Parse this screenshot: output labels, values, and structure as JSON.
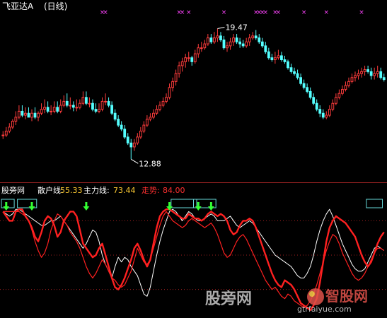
{
  "colors": {
    "background": "#000000",
    "up_candle": "#ff3c3c",
    "down_candle": "#54ffff",
    "marker": "#ff44ff",
    "main_force": "#ff2020",
    "retail": "#ffffff",
    "trend": "#ff2020",
    "signal": "#33ff33",
    "box": "#66d8d8",
    "volume": "#c84bd8",
    "divider": "#9b2222",
    "title_text": "#ffffff",
    "value_text": "#ffcc33",
    "trend_value_text": "#ff3030",
    "watermark": "#c8c8c8",
    "ref_line": "#a01f1f"
  },
  "main_panel": {
    "title": "飞亚达A",
    "period": "(日线)",
    "high_label": "19.47",
    "low_label": "12.88",
    "grid_levels": [
      "",
      "",
      ""
    ]
  },
  "indicator_panel": {
    "name": "股旁网",
    "retail_label": "散户线:",
    "retail_value": "55.33",
    "main_label": "主力线:",
    "main_value": "73.44",
    "trend_label": "走势:",
    "trend_value": "84.00"
  },
  "watermark": {
    "left_text": "股旁网",
    "right_text": "智股网",
    "url_text": "gtrfaiyue.com"
  },
  "chart_data": [
    {
      "type": "candlestick",
      "title": "飞亚达A",
      "period": "(日线)",
      "ylim": [
        12.0,
        20.2
      ],
      "annotations": [
        {
          "text": "19.47",
          "x": 67,
          "y": 19.47
        },
        {
          "text": "12.88",
          "x": 40,
          "y": 12.88
        }
      ],
      "marker_x": [
        31,
        32,
        55,
        56,
        58,
        69,
        79,
        80,
        81,
        82,
        85,
        86,
        94,
        101,
        112
      ],
      "x": [
        0,
        1,
        2,
        3,
        4,
        5,
        6,
        7,
        8,
        9,
        10,
        11,
        12,
        13,
        14,
        15,
        16,
        17,
        18,
        19,
        20,
        21,
        22,
        23,
        24,
        25,
        26,
        27,
        28,
        29,
        30,
        31,
        32,
        33,
        34,
        35,
        36,
        37,
        38,
        39,
        40,
        41,
        42,
        43,
        44,
        45,
        46,
        47,
        48,
        49,
        50,
        51,
        52,
        53,
        54,
        55,
        56,
        57,
        58,
        59,
        60,
        61,
        62,
        63,
        64,
        65,
        66,
        67,
        68,
        69,
        70,
        71,
        72,
        73,
        74,
        75,
        76,
        77,
        78,
        79,
        80,
        81,
        82,
        83,
        84,
        85,
        86,
        87,
        88,
        89,
        90,
        91,
        92,
        93,
        94,
        95,
        96,
        97,
        98,
        99,
        100,
        101,
        102,
        103,
        104,
        105,
        106,
        107,
        108,
        109,
        110,
        111,
        112,
        113,
        114,
        115,
        116,
        117,
        118,
        119
      ],
      "open": [
        14.1,
        14.1,
        14.3,
        14.5,
        14.8,
        15.0,
        15.3,
        15.1,
        15.2,
        15.0,
        15.2,
        15.0,
        15.2,
        15.4,
        15.5,
        15.3,
        15.3,
        15.5,
        15.3,
        15.6,
        15.8,
        15.6,
        15.6,
        15.5,
        15.5,
        15.7,
        16.0,
        15.7,
        15.7,
        15.4,
        15.3,
        15.4,
        15.8,
        15.8,
        15.6,
        15.2,
        14.9,
        14.6,
        14.4,
        14.0,
        13.7,
        13.5,
        13.7,
        14.0,
        14.3,
        14.6,
        14.9,
        15.0,
        15.2,
        15.4,
        15.6,
        15.8,
        16.0,
        16.5,
        16.8,
        17.2,
        17.6,
        17.8,
        18.0,
        18.0,
        17.8,
        18.2,
        18.5,
        18.5,
        18.7,
        19.0,
        18.8,
        19.0,
        19.1,
        18.9,
        18.5,
        18.6,
        18.8,
        19.0,
        18.8,
        18.7,
        18.6,
        18.8,
        19.0,
        19.1,
        19.0,
        18.8,
        18.6,
        18.3,
        18.0,
        17.9,
        18.0,
        18.1,
        17.9,
        17.8,
        17.5,
        17.3,
        17.2,
        17.0,
        16.7,
        16.5,
        16.3,
        16.0,
        15.7,
        15.4,
        15.2,
        15.0,
        15.1,
        15.4,
        15.7,
        16.0,
        16.2,
        16.4,
        16.6,
        16.8,
        17.0,
        17.1,
        17.2,
        17.3,
        17.4,
        17.3,
        17.1,
        17.2,
        17.3,
        17.0
      ],
      "high": [
        14.3,
        14.5,
        14.7,
        14.9,
        15.3,
        15.6,
        15.6,
        15.5,
        15.5,
        15.4,
        15.5,
        15.3,
        15.7,
        15.9,
        15.8,
        15.6,
        15.8,
        15.8,
        15.9,
        16.1,
        16.2,
        16.0,
        15.8,
        15.9,
        15.9,
        16.3,
        16.3,
        16.0,
        15.9,
        15.7,
        15.7,
        16.0,
        16.2,
        16.0,
        15.8,
        15.4,
        15.1,
        14.8,
        14.6,
        14.2,
        13.9,
        13.9,
        14.2,
        14.5,
        14.8,
        15.1,
        15.2,
        15.4,
        15.6,
        15.8,
        16.0,
        16.2,
        16.7,
        17.0,
        17.4,
        17.8,
        18.0,
        18.2,
        18.3,
        18.1,
        18.4,
        18.7,
        18.8,
        18.9,
        19.2,
        19.2,
        19.3,
        19.47,
        19.3,
        19.1,
        18.8,
        19.0,
        19.2,
        19.2,
        19.0,
        18.9,
        19.0,
        19.2,
        19.3,
        19.4,
        19.2,
        19.0,
        18.8,
        18.5,
        18.2,
        18.3,
        18.4,
        18.3,
        18.1,
        17.9,
        17.7,
        17.5,
        17.4,
        17.2,
        16.9,
        16.7,
        16.5,
        16.2,
        15.9,
        15.6,
        15.4,
        15.3,
        15.6,
        15.9,
        16.2,
        16.4,
        16.6,
        16.8,
        17.0,
        17.2,
        17.3,
        17.4,
        17.5,
        17.6,
        17.6,
        17.5,
        17.5,
        17.6,
        17.5,
        17.2
      ],
      "low": [
        13.9,
        14.0,
        14.2,
        14.4,
        14.6,
        14.9,
        15.0,
        14.9,
        15.0,
        14.8,
        14.9,
        14.8,
        15.1,
        15.2,
        15.2,
        15.1,
        15.2,
        15.2,
        15.2,
        15.5,
        15.5,
        15.4,
        15.3,
        15.3,
        15.4,
        15.6,
        15.6,
        15.5,
        15.3,
        15.2,
        15.2,
        15.3,
        15.6,
        15.5,
        15.1,
        14.8,
        14.5,
        14.3,
        13.9,
        13.6,
        12.88,
        13.3,
        13.6,
        13.9,
        14.2,
        14.5,
        14.8,
        14.9,
        15.1,
        15.3,
        15.5,
        15.7,
        15.9,
        16.3,
        16.6,
        17.0,
        17.3,
        17.5,
        17.8,
        17.6,
        17.7,
        18.0,
        18.3,
        18.4,
        18.6,
        18.7,
        18.7,
        18.8,
        18.8,
        18.4,
        18.3,
        18.4,
        18.6,
        18.7,
        18.5,
        18.5,
        18.5,
        18.6,
        18.9,
        18.9,
        18.7,
        18.5,
        18.2,
        17.9,
        17.8,
        17.7,
        17.9,
        17.8,
        17.7,
        17.4,
        17.2,
        17.1,
        16.9,
        16.6,
        16.4,
        16.2,
        15.9,
        15.6,
        15.3,
        15.0,
        14.9,
        14.9,
        15.0,
        15.3,
        15.6,
        15.9,
        16.1,
        16.3,
        16.5,
        16.7,
        16.8,
        16.9,
        17.0,
        17.1,
        17.2,
        16.9,
        16.9,
        17.0,
        16.9,
        16.8
      ],
      "close": [
        14.1,
        14.3,
        14.5,
        14.8,
        15.0,
        15.3,
        15.1,
        15.2,
        15.0,
        15.2,
        15.0,
        15.2,
        15.4,
        15.5,
        15.3,
        15.3,
        15.5,
        15.3,
        15.6,
        15.8,
        15.6,
        15.6,
        15.5,
        15.5,
        15.7,
        16.0,
        15.7,
        15.7,
        15.4,
        15.3,
        15.4,
        15.8,
        15.8,
        15.6,
        15.2,
        14.9,
        14.6,
        14.4,
        14.0,
        13.7,
        13.5,
        13.7,
        14.0,
        14.3,
        14.6,
        14.9,
        15.0,
        15.2,
        15.4,
        15.6,
        15.8,
        16.0,
        16.5,
        16.8,
        17.2,
        17.6,
        17.8,
        18.0,
        18.0,
        17.8,
        18.2,
        18.5,
        18.5,
        18.7,
        19.0,
        18.8,
        19.0,
        19.1,
        18.9,
        18.5,
        18.6,
        18.8,
        19.0,
        18.8,
        18.7,
        18.6,
        18.8,
        19.0,
        19.1,
        19.0,
        18.8,
        18.6,
        18.3,
        18.0,
        17.9,
        18.0,
        18.1,
        17.9,
        17.8,
        17.5,
        17.3,
        17.2,
        17.0,
        16.7,
        16.5,
        16.3,
        16.0,
        15.7,
        15.4,
        15.2,
        15.0,
        15.1,
        15.4,
        15.7,
        16.0,
        16.2,
        16.4,
        16.6,
        16.8,
        17.0,
        17.1,
        17.2,
        17.3,
        17.4,
        17.3,
        17.1,
        17.2,
        17.3,
        17.0,
        16.9
      ]
    },
    {
      "type": "line",
      "title": "股旁网",
      "ylim": [
        0,
        100
      ],
      "x": [
        0,
        1,
        2,
        3,
        4,
        5,
        6,
        7,
        8,
        9,
        10,
        11,
        12,
        13,
        14,
        15,
        16,
        17,
        18,
        19,
        20,
        21,
        22,
        23,
        24,
        25,
        26,
        27,
        28,
        29,
        30,
        31,
        32,
        33,
        34,
        35,
        36,
        37,
        38,
        39,
        40,
        41,
        42,
        43,
        44,
        45,
        46,
        47,
        48,
        49,
        50,
        51,
        52,
        53,
        54,
        55,
        56,
        57,
        58,
        59,
        60,
        61,
        62,
        63,
        64,
        65,
        66,
        67,
        68,
        69,
        70,
        71,
        72,
        73,
        74,
        75,
        76,
        77,
        78,
        79,
        80,
        81,
        82,
        83,
        84,
        85,
        86,
        87,
        88,
        89,
        90,
        91,
        92,
        93,
        94,
        95,
        96,
        97,
        98,
        99,
        100,
        101,
        102,
        103,
        104,
        105,
        106,
        107,
        108,
        109,
        110,
        111,
        112,
        113,
        114,
        115,
        116,
        117,
        118,
        119
      ],
      "series": [
        {
          "name": "散户线",
          "role": "retail",
          "values": [
            88,
            86,
            84,
            86,
            90,
            90,
            88,
            86,
            84,
            82,
            80,
            78,
            76,
            76,
            78,
            80,
            80,
            82,
            84,
            80,
            76,
            72,
            68,
            64,
            60,
            56,
            60,
            66,
            72,
            70,
            62,
            50,
            42,
            36,
            30,
            40,
            48,
            44,
            48,
            46,
            40,
            36,
            32,
            24,
            16,
            14,
            22,
            36,
            50,
            62,
            72,
            80,
            88,
            90,
            88,
            84,
            80,
            84,
            88,
            86,
            82,
            80,
            80,
            82,
            84,
            86,
            84,
            80,
            80,
            80,
            82,
            84,
            80,
            76,
            74,
            76,
            78,
            80,
            78,
            74,
            70,
            66,
            62,
            58,
            54,
            50,
            48,
            46,
            44,
            42,
            40,
            36,
            32,
            30,
            30,
            34,
            40,
            50,
            62,
            72,
            80,
            86,
            90,
            84,
            76,
            68,
            60,
            54,
            48,
            42,
            38,
            36,
            36,
            38,
            44,
            50,
            56,
            58,
            56,
            54
          ]
        },
        {
          "name": "主力线",
          "role": "main",
          "values": [
            88,
            84,
            80,
            80,
            88,
            90,
            90,
            84,
            80,
            74,
            66,
            62,
            70,
            80,
            84,
            82,
            76,
            66,
            70,
            80,
            84,
            88,
            88,
            84,
            72,
            60,
            56,
            52,
            48,
            50,
            56,
            60,
            50,
            40,
            30,
            22,
            20,
            24,
            30,
            38,
            46,
            56,
            60,
            54,
            46,
            40,
            46,
            60,
            74,
            84,
            88,
            90,
            90,
            88,
            86,
            84,
            82,
            82,
            86,
            84,
            82,
            82,
            80,
            82,
            86,
            88,
            86,
            84,
            86,
            84,
            80,
            72,
            68,
            70,
            76,
            80,
            80,
            82,
            80,
            74,
            66,
            58,
            50,
            42,
            34,
            28,
            24,
            22,
            28,
            26,
            24,
            20,
            14,
            8,
            6,
            4,
            2,
            6,
            12,
            26,
            44,
            62,
            74,
            80,
            84,
            82,
            80,
            78,
            74,
            70,
            66,
            58,
            50,
            44,
            40,
            44,
            52,
            60,
            66,
            70
          ]
        },
        {
          "name": "走势",
          "role": "trend",
          "values": [
            88,
            88,
            88,
            88,
            88,
            88,
            86,
            84,
            80,
            72,
            62,
            54,
            48,
            52,
            60,
            72,
            80,
            86,
            84,
            80,
            76,
            70,
            66,
            62,
            56,
            48,
            40,
            34,
            30,
            34,
            40,
            46,
            42,
            36,
            30,
            28,
            24,
            22,
            24,
            30,
            36,
            46,
            56,
            50,
            44,
            42,
            46,
            56,
            66,
            76,
            84,
            88,
            84,
            80,
            78,
            76,
            74,
            76,
            80,
            82,
            80,
            78,
            76,
            74,
            76,
            78,
            74,
            68,
            60,
            52,
            48,
            50,
            56,
            62,
            66,
            68,
            64,
            58,
            52,
            46,
            40,
            34,
            28,
            24,
            20,
            22,
            18,
            14,
            12,
            16,
            14,
            10,
            8,
            6,
            4,
            6,
            10,
            16,
            24,
            34,
            44,
            54,
            62,
            68,
            66,
            60,
            52,
            46,
            40,
            34,
            30,
            28,
            30,
            34,
            40,
            46,
            52,
            56,
            56,
            54
          ]
        },
        {
          "name": "",
          "role": "volume",
          "values": [
            0,
            0,
            0,
            0,
            0,
            0,
            0,
            0,
            0,
            0,
            0,
            0,
            0,
            0,
            0,
            0,
            0,
            0,
            0,
            0,
            0,
            0,
            0,
            0,
            0,
            0,
            0,
            0,
            0,
            0,
            0,
            0,
            0,
            0,
            0,
            0,
            0,
            0,
            0,
            0,
            0,
            0,
            0,
            0,
            0,
            0,
            0,
            0,
            0,
            0,
            0,
            0,
            0,
            0,
            0,
            0,
            0,
            0,
            0,
            0,
            0,
            0,
            0,
            0,
            0,
            0,
            0,
            0,
            0,
            0,
            0,
            0,
            0,
            0,
            0,
            0,
            0,
            0,
            0,
            0,
            0,
            0,
            0,
            0,
            0,
            0,
            0,
            0,
            0,
            0,
            0,
            0,
            0,
            0,
            0,
            0,
            0,
            0,
            0,
            0,
            0,
            0,
            0,
            0,
            0,
            0,
            0,
            0,
            0,
            0,
            0,
            0,
            0,
            0,
            0,
            0,
            0,
            0,
            0,
            0
          ]
        }
      ],
      "signal_arrows_x": [
        1,
        9,
        26,
        52,
        61,
        65
      ],
      "signal_boxes": [
        {
          "from": 0,
          "to": 3
        },
        {
          "from": 5,
          "to": 10
        },
        {
          "from": 53,
          "to": 60
        },
        {
          "from": 60,
          "to": 66
        },
        {
          "from": 114,
          "to": 118
        }
      ]
    }
  ]
}
